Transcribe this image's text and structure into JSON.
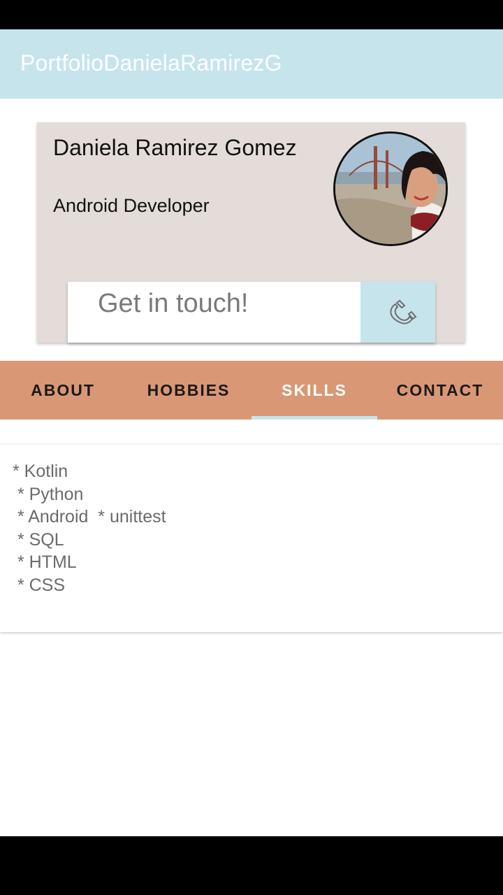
{
  "app_bar": {
    "title": "PortfolioDanielaRamirezG",
    "color": "#c6e4ec"
  },
  "profile": {
    "name": "Daniela Ramirez Gomez",
    "role": "Android Developer",
    "card_color": "#e3dcd8"
  },
  "contact_prompt": {
    "label": "Get in touch!",
    "icon": "phone-icon"
  },
  "tabs": {
    "color": "#da9775",
    "selected": "SKILLS",
    "items": [
      {
        "label": "ABOUT"
      },
      {
        "label": "HOBBIES"
      },
      {
        "label": "SKILLS"
      },
      {
        "label": "CONTACT"
      }
    ]
  },
  "skills": {
    "text": "* Kotlin\n * Python\n * Android  * unittest\n * SQL\n * HTML\n * CSS"
  }
}
